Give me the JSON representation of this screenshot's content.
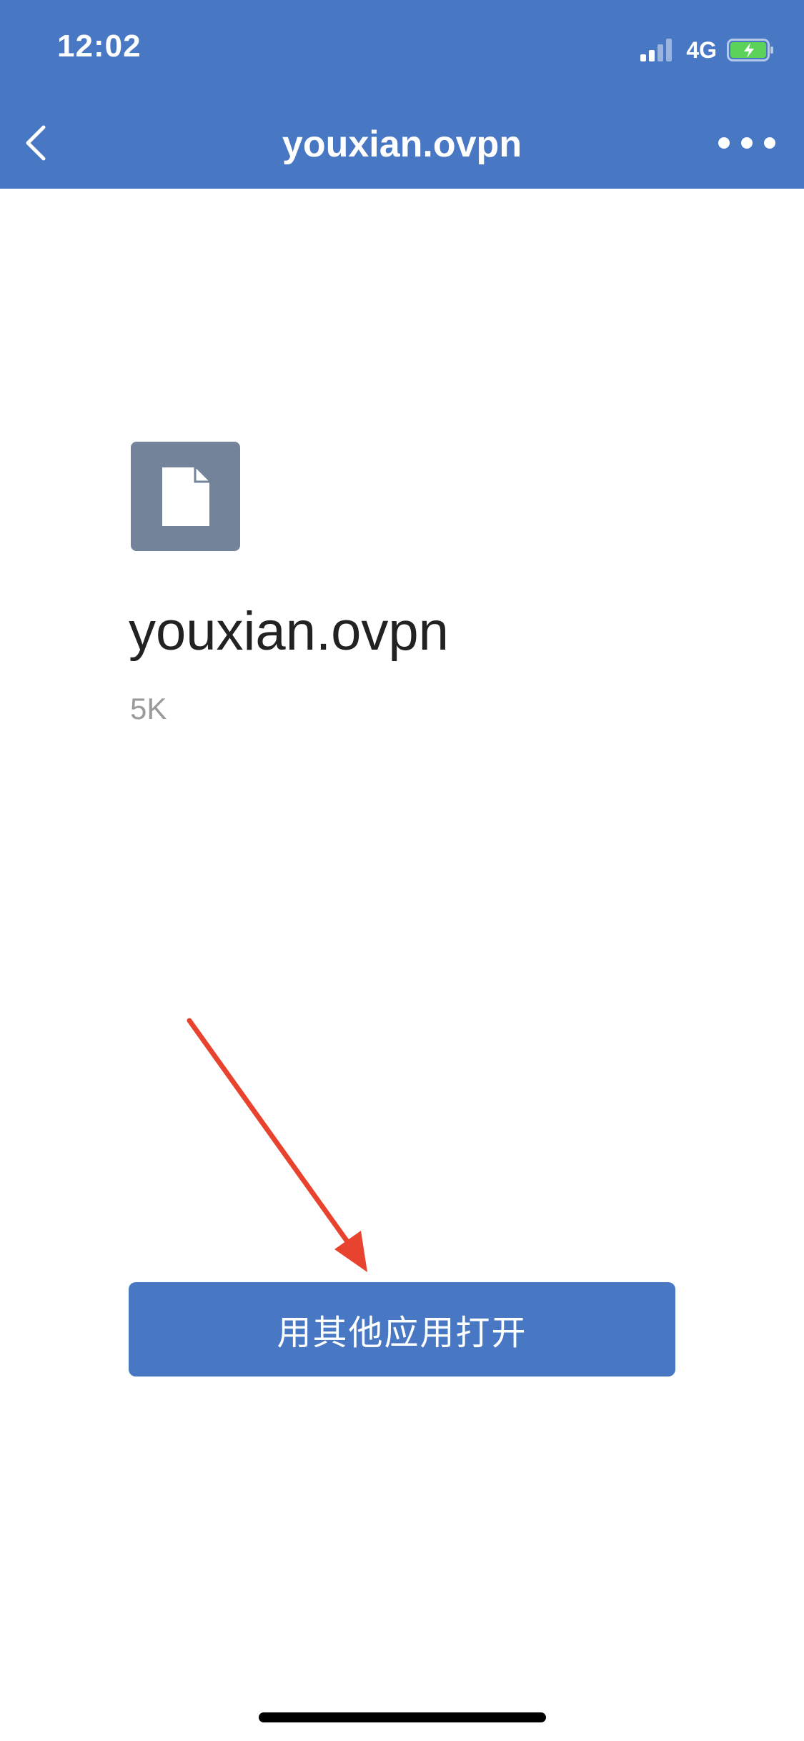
{
  "status_bar": {
    "time": "12:02",
    "network": "4G"
  },
  "nav": {
    "title": "youxian.ovpn"
  },
  "file": {
    "name": "youxian.ovpn",
    "size": "5K"
  },
  "action": {
    "label": "用其他应用打开"
  },
  "colors": {
    "header": "#4877C4",
    "button": "#4877C4",
    "arrow": "#E8432E",
    "file_icon_bg": "#73839A",
    "battery": "#5BD35B"
  },
  "icons": {
    "back": "chevron-left-icon",
    "more": "more-icon",
    "file": "document-icon"
  }
}
